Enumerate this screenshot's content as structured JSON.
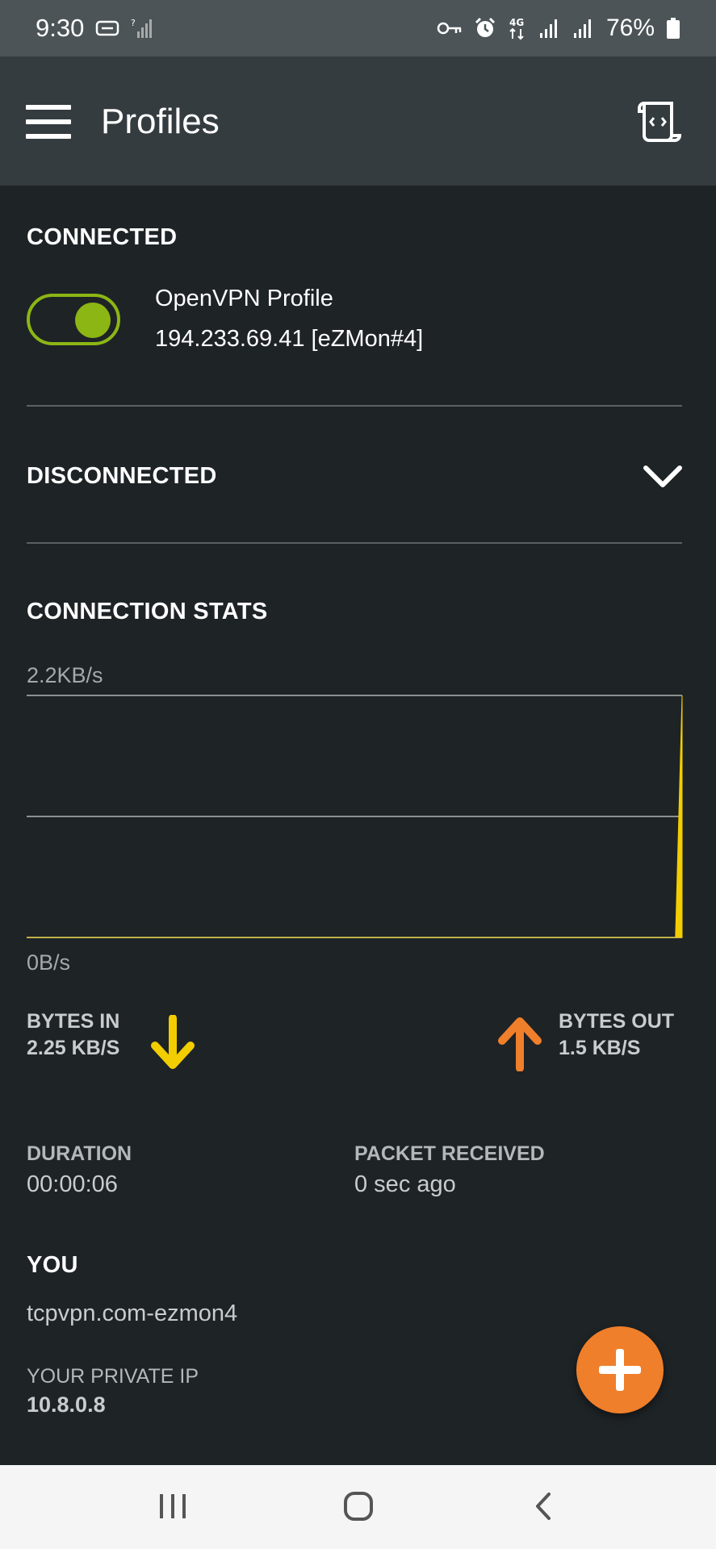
{
  "status_bar": {
    "time": "9:30",
    "battery_percent": "76%",
    "icons": [
      "message-icon",
      "signal-x-icon",
      "vpn-key-icon",
      "alarm-icon",
      "4g-icon",
      "signal-icon",
      "signal-icon",
      "battery-icon"
    ]
  },
  "app_bar": {
    "title": "Profiles",
    "icons": [
      "menu-icon",
      "log-scroll-icon"
    ]
  },
  "connected": {
    "header": "CONNECTED",
    "toggle_on": true,
    "profile_name": "OpenVPN Profile",
    "profile_server": "194.233.69.41 [eZMon#4]"
  },
  "disconnected": {
    "header": "DISCONNECTED",
    "icon": "chevron-down-icon"
  },
  "stats": {
    "header": "CONNECTION STATS",
    "chart_data": {
      "type": "area",
      "y_max_label": "2.2KB/s",
      "y_min_label": "0B/s",
      "ylim": [
        0,
        2.2
      ],
      "grid": true,
      "series": [
        {
          "color": "#f2cd00",
          "values": [
            0,
            0,
            0,
            0,
            0,
            0,
            0,
            0,
            0,
            0,
            0,
            0,
            0,
            0,
            0,
            0,
            0,
            0,
            0,
            0,
            0,
            0,
            0,
            0,
            0,
            0,
            0,
            0,
            0,
            0,
            0,
            0,
            0,
            0,
            0,
            0,
            0,
            0,
            0,
            0,
            0,
            0,
            0,
            0,
            0,
            0,
            0,
            0,
            0,
            0,
            0,
            0,
            0,
            0,
            0,
            0,
            0,
            0,
            0,
            0,
            0,
            0,
            0,
            0,
            0,
            0,
            0,
            0,
            0,
            0,
            0,
            0,
            0,
            0,
            0,
            0,
            0,
            0,
            0,
            0,
            0,
            0,
            0,
            0,
            0,
            0,
            0,
            0,
            0,
            0,
            0,
            0,
            0,
            0,
            0,
            0,
            0,
            0,
            0,
            2.2
          ]
        }
      ]
    },
    "bytes_in_label": "BYTES IN",
    "bytes_in_value": "2.25 KB/S",
    "bytes_out_label": "BYTES OUT",
    "bytes_out_value": "1.5 KB/S",
    "in_color": "#f2cd00",
    "out_color": "#ef7f2a"
  },
  "info": {
    "duration_label": "DURATION",
    "duration_value": "00:00:06",
    "packet_label": "PACKET RECEIVED",
    "packet_value": "0 sec ago",
    "you_header": "YOU",
    "you_value": "tcpvpn.com-ezmon4",
    "private_ip_label": "YOUR PRIVATE IP",
    "private_ip_value": "10.8.0.8"
  },
  "fab": {
    "icon": "plus-icon",
    "color": "#ef7f2a"
  },
  "nav_bar": {
    "icons": [
      "recent-apps-icon",
      "home-icon",
      "back-icon"
    ]
  }
}
